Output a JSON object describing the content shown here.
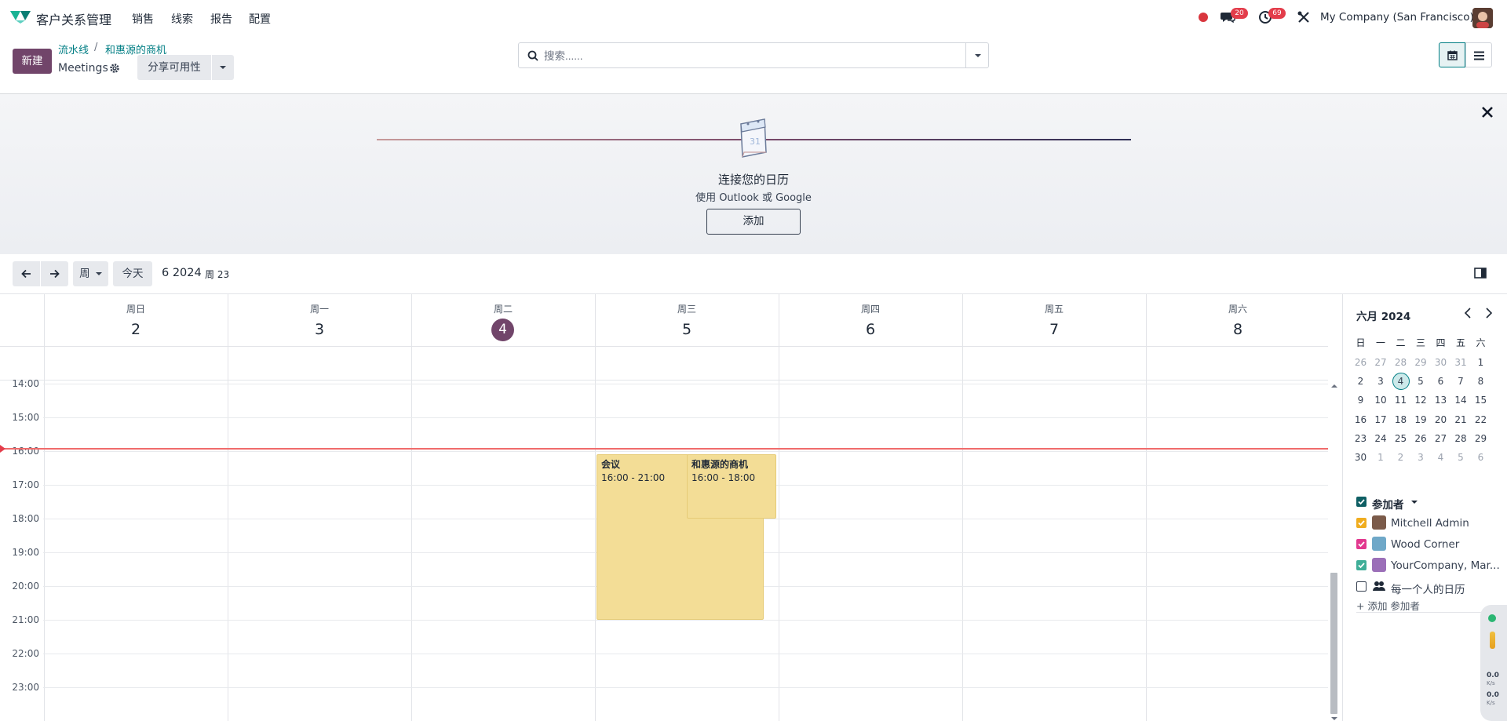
{
  "nav": {
    "app_title": "客户关系管理",
    "menu": [
      "销售",
      "线索",
      "报告",
      "配置"
    ],
    "messages_count": "20",
    "activities_count": "69",
    "company": "My Company (San Francisco)"
  },
  "control": {
    "new_label": "新建",
    "breadcrumb": [
      "流水线",
      "和惠源的商机"
    ],
    "page_title": "Meetings",
    "share_label": "分享可用性",
    "search_placeholder": "搜索......"
  },
  "banner": {
    "title": "连接您的日历",
    "subtitle": "使用 Outlook 或 Google",
    "add_label": "添加",
    "calendar_glyph": "31"
  },
  "toolbar": {
    "scale_label": "周",
    "today_label": "今天",
    "range": "6 2024",
    "week": "周 23"
  },
  "week": {
    "days": [
      {
        "name": "周日",
        "num": "2",
        "today": false
      },
      {
        "name": "周一",
        "num": "3",
        "today": false
      },
      {
        "name": "周二",
        "num": "4",
        "today": true
      },
      {
        "name": "周三",
        "num": "5",
        "today": false
      },
      {
        "name": "周四",
        "num": "6",
        "today": false
      },
      {
        "name": "周五",
        "num": "7",
        "today": false
      },
      {
        "name": "周六",
        "num": "8",
        "today": false
      }
    ],
    "hours": [
      "14:00",
      "15:00",
      "16:00",
      "17:00",
      "18:00",
      "19:00",
      "20:00",
      "21:00",
      "22:00",
      "23:00"
    ],
    "events": [
      {
        "title": "会议",
        "time": "16:00 - 21:00",
        "day_index": 3
      },
      {
        "title": "和惠源的商机",
        "time": "16:00 - 18:00",
        "day_index": 3
      }
    ]
  },
  "mini_calendar": {
    "title": "六月 2024",
    "dow": [
      "日",
      "一",
      "二",
      "三",
      "四",
      "五",
      "六"
    ],
    "weeks": [
      [
        {
          "d": "26",
          "m": 1
        },
        {
          "d": "27",
          "m": 1
        },
        {
          "d": "28",
          "m": 1
        },
        {
          "d": "29",
          "m": 1
        },
        {
          "d": "30",
          "m": 1
        },
        {
          "d": "31",
          "m": 1
        },
        {
          "d": "1",
          "m": 0
        }
      ],
      [
        {
          "d": "2",
          "m": 0
        },
        {
          "d": "3",
          "m": 0
        },
        {
          "d": "4",
          "m": 0,
          "t": 1
        },
        {
          "d": "5",
          "m": 0
        },
        {
          "d": "6",
          "m": 0
        },
        {
          "d": "7",
          "m": 0
        },
        {
          "d": "8",
          "m": 0
        }
      ],
      [
        {
          "d": "9",
          "m": 0
        },
        {
          "d": "10",
          "m": 0
        },
        {
          "d": "11",
          "m": 0
        },
        {
          "d": "12",
          "m": 0
        },
        {
          "d": "13",
          "m": 0
        },
        {
          "d": "14",
          "m": 0
        },
        {
          "d": "15",
          "m": 0
        }
      ],
      [
        {
          "d": "16",
          "m": 0
        },
        {
          "d": "17",
          "m": 0
        },
        {
          "d": "18",
          "m": 0
        },
        {
          "d": "19",
          "m": 0
        },
        {
          "d": "20",
          "m": 0
        },
        {
          "d": "21",
          "m": 0
        },
        {
          "d": "22",
          "m": 0
        }
      ],
      [
        {
          "d": "23",
          "m": 0
        },
        {
          "d": "24",
          "m": 0
        },
        {
          "d": "25",
          "m": 0
        },
        {
          "d": "26",
          "m": 0
        },
        {
          "d": "27",
          "m": 0
        },
        {
          "d": "28",
          "m": 0
        },
        {
          "d": "29",
          "m": 0
        }
      ],
      [
        {
          "d": "30",
          "m": 0
        },
        {
          "d": "1",
          "m": 1
        },
        {
          "d": "2",
          "m": 1
        },
        {
          "d": "3",
          "m": 1
        },
        {
          "d": "4",
          "m": 1
        },
        {
          "d": "5",
          "m": 1
        },
        {
          "d": "6",
          "m": 1
        }
      ]
    ]
  },
  "attendees": {
    "header": "参加者",
    "items": [
      {
        "name": "Mitchell Admin",
        "color": "#f0ad1f",
        "checked": true
      },
      {
        "name": "Wood Corner",
        "color": "#e2398f",
        "checked": true
      },
      {
        "name": "YourCompany, Mar...",
        "color": "#3fae98",
        "checked": true
      },
      {
        "name": "每一个人的日历",
        "color": "#ffffff",
        "checked": false
      }
    ],
    "add_label": "+ 添加 参加者"
  },
  "debug_widget": {
    "value_1": "0.0",
    "value_2": "0.0",
    "unit": "K/s"
  },
  "colors": {
    "brand": "#71456a",
    "accent": "#017e84",
    "event": "#f3dd96",
    "now_line": "#f06b6b"
  }
}
